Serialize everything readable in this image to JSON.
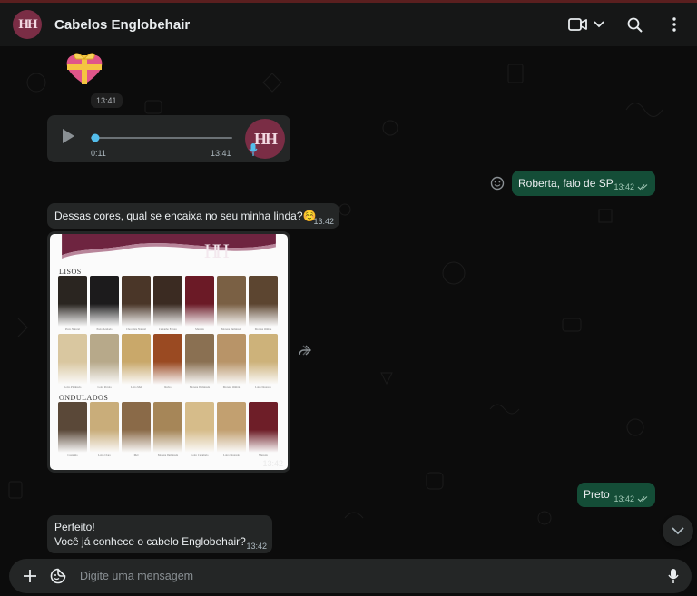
{
  "header": {
    "avatar_initials": "HH",
    "title": "Cabelos Englobehair",
    "icons": [
      "video-call-icon",
      "chevron-down-icon",
      "search-icon",
      "menu-dots-icon"
    ]
  },
  "messages": {
    "sticker_time": "13:41",
    "audio": {
      "elapsed": "0:11",
      "time": "13:41",
      "avatar_initials": "HH",
      "progress": 0
    },
    "out1": {
      "text": "Roberta, falo de SP",
      "time": "13:42"
    },
    "in1": {
      "text": "Dessas cores, qual se encaixa no seu minha linda?☺️",
      "time": "13:42"
    },
    "image": {
      "time": "13:42",
      "logo": "HH",
      "section1": "LISOS",
      "section2": "ONDULADOS",
      "captions_row1": [
        "Preto Natural",
        "Preto Azulado",
        "Chocolate Natural",
        "Castanho Escuro",
        "Marsala",
        "Morena Iluminada",
        "Morena Ombre"
      ],
      "captions_row2": [
        "Loiro Platinado",
        "Loiro Perola",
        "Loiro Mel",
        "Ruivo",
        "Morena Iluminada",
        "Morena Ombré",
        "Loiro Dourado"
      ],
      "captions_row3": [
        "Castanho",
        "Loiro Claro",
        "Mel",
        "Morena Iluminada",
        "Loiro Caramelo",
        "Loiro Dourado",
        "Marsala"
      ]
    },
    "out2": {
      "text": "Preto",
      "time": "13:42"
    },
    "in2": {
      "line1": "Perfeito!",
      "line2": "Você já conhece o cabelo Englobehair?",
      "time": "13:42"
    }
  },
  "composer": {
    "placeholder": "Digite uma mensagem"
  },
  "colors": {
    "header_bg": "#161717",
    "chat_bg": "#0c0c0c",
    "bubble_in": "#242626",
    "bubble_out": "#144d37",
    "brand": "#7a2d45",
    "accent": "#53bdeb"
  }
}
